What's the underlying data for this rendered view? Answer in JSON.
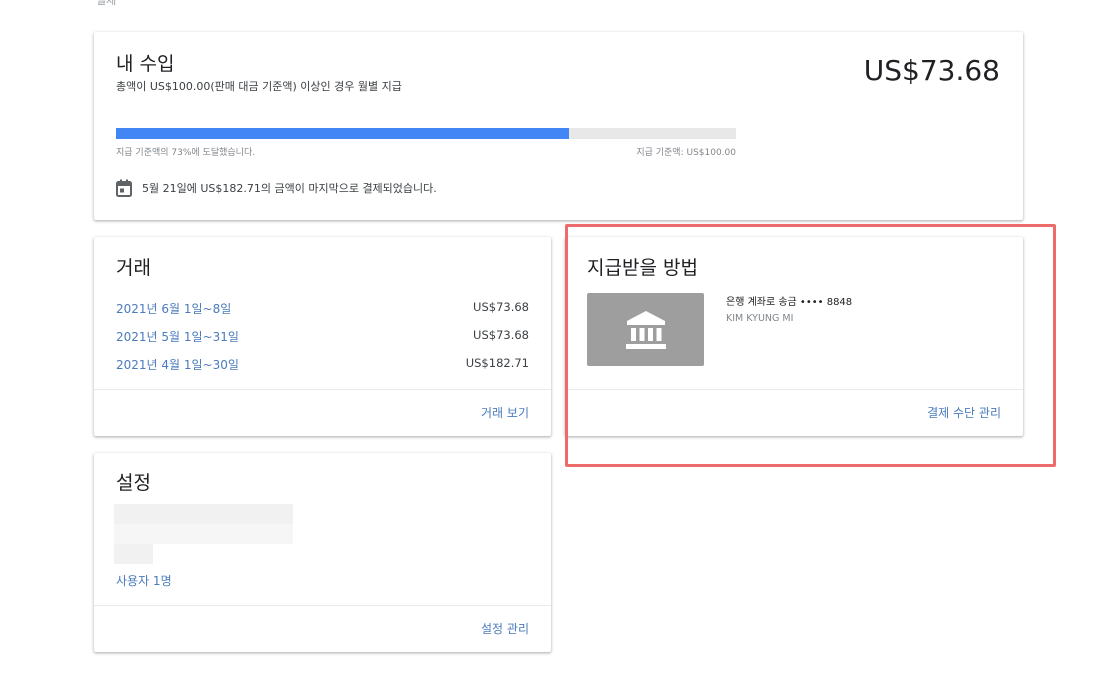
{
  "top_cut_text": "일체",
  "earnings": {
    "title": "내 수입",
    "subtitle": "총액이 US$100.00(판매 대금 기준액) 이상인 경우 월별 지급",
    "balance": "US$73.68",
    "progress_fraction": 0.73,
    "progress_left_label": "지급 기준액의 73%에 도달했습니다.",
    "progress_right_label": "지급 기준액: US$100.00",
    "last_payment_text": "5월 21일에 US$182.71의 금액이 마지막으로 결제되었습니다.",
    "calendar_icon": "calendar-icon",
    "accent_color": "#4285f4"
  },
  "transactions": {
    "title": "거래",
    "rows": [
      {
        "period": "2021년 6월 1일~8일",
        "amount": "US$73.68"
      },
      {
        "period": "2021년 5월 1일~31일",
        "amount": "US$73.68"
      },
      {
        "period": "2021년 4월 1일~30일",
        "amount": "US$182.71"
      }
    ],
    "action": "거래 보기"
  },
  "payment": {
    "title": "지급받을 방법",
    "icon": "bank-icon",
    "method": "은행 계좌로 송금 •••• 8848",
    "account_holder": "KIM KYUNG MI",
    "action": "결제 수단 관리",
    "highlight_color": "#ee6b6b"
  },
  "settings": {
    "title": "설정",
    "users_link": "사용자 1명",
    "action": "설정 관리"
  }
}
